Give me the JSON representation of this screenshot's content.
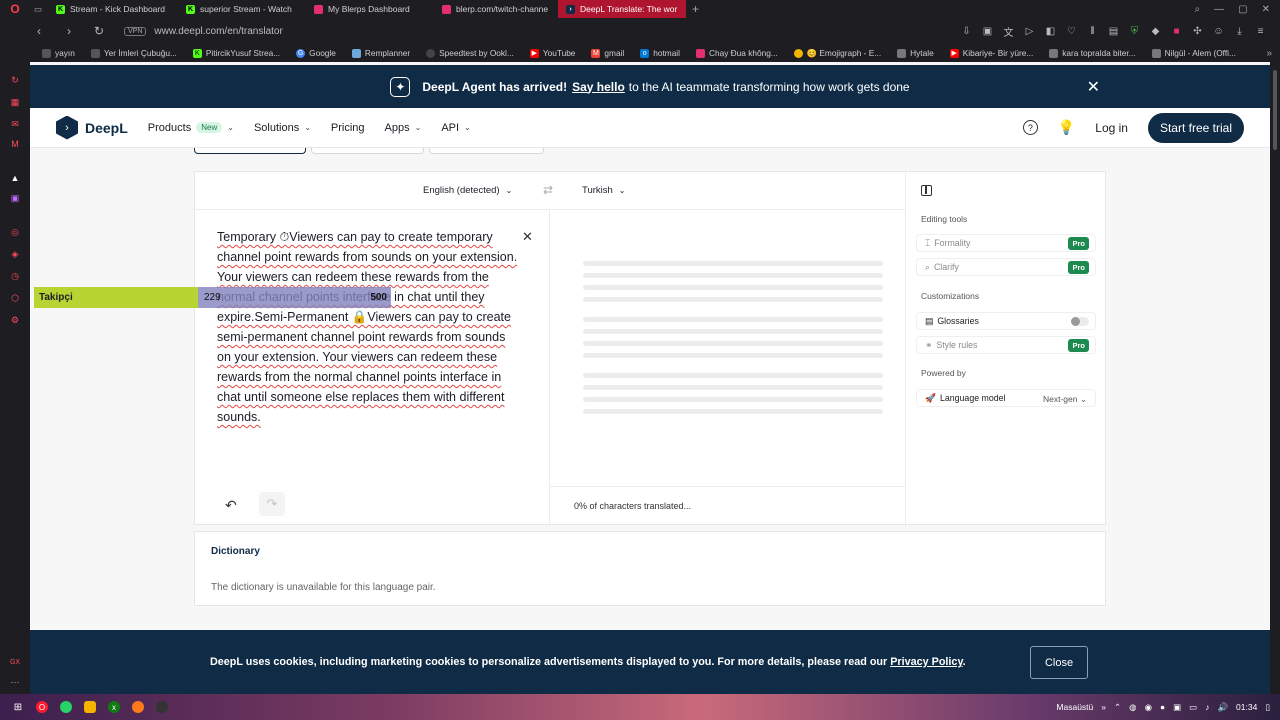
{
  "browser": {
    "tabs": [
      {
        "title": "Stream - Kick Dashboard",
        "color": "#53fc18",
        "glyph": "K"
      },
      {
        "title": "superior Stream - Watch",
        "color": "#53fc18",
        "glyph": "K"
      },
      {
        "title": "My Blerps Dashboard",
        "color": "#e3306c",
        "glyph": ""
      },
      {
        "title": "blerp.com/twitch-channe",
        "color": "#e3306c",
        "glyph": ""
      },
      {
        "title": "DeepL Translate: The wor",
        "color": "#0f2b46",
        "glyph": "D"
      }
    ],
    "url": "www.deepl.com/en/translator",
    "vpn_label": "VPN",
    "bookmarks": [
      {
        "label": "yayın",
        "color": "#888"
      },
      {
        "label": "Yer İmleri Çubuğu...",
        "color": "#888"
      },
      {
        "label": "PitircikYusuf Strea...",
        "color": "#53fc18"
      },
      {
        "label": "Google",
        "color": "#4285f4"
      },
      {
        "label": "Remplanner",
        "color": "#6fa8dc"
      },
      {
        "label": "Speedtest by Ookl...",
        "color": "#666"
      },
      {
        "label": "YouTube",
        "color": "#ff0000"
      },
      {
        "label": "gmail",
        "color": "#ea4335"
      },
      {
        "label": "hotmail",
        "color": "#0078d4"
      },
      {
        "label": "Chạy Đua không...",
        "color": "#e3306c"
      },
      {
        "label": "😊 Emojigraph - E...",
        "color": "#f4b400"
      },
      {
        "label": "Hytale",
        "color": "#777"
      },
      {
        "label": "Kibariye- Bir yüre...",
        "color": "#ff0000"
      },
      {
        "label": "kara topralda biter...",
        "color": "#777"
      },
      {
        "label": "Nilgül - Alem (Offi...",
        "color": "#777"
      }
    ]
  },
  "banner": {
    "title": "DeepL Agent has arrived!",
    "link": "Say hello",
    "rest": "to the AI teammate transforming how work gets done"
  },
  "header": {
    "logo": "DeepL",
    "nav": {
      "products": "Products",
      "new_badge": "New",
      "solutions": "Solutions",
      "pricing": "Pricing",
      "apps": "Apps",
      "api": "API"
    },
    "login": "Log in",
    "trial": "Start free trial"
  },
  "translator": {
    "source_lang": "English (detected)",
    "target_lang": "Turkish",
    "source_text": "Temporary ⏱Viewers can pay to create temporary channel point rewards from sounds on your extension. Your viewers can redeem these rewards from the normal channel points interface in chat until they expire.Semi-Permanent 🔒Viewers can pay to create semi-permanent channel point rewards from sounds on your extension. Your viewers can redeem these rewards from the normal channel points interface in chat until someone else replaces them with different sounds.",
    "progress": "0% of characters translated..."
  },
  "tools": {
    "editing_title": "Editing tools",
    "formality": "Formality",
    "clarify": "Clarify",
    "customizations_title": "Customizations",
    "glossaries": "Glossaries",
    "style_rules": "Style rules",
    "powered_title": "Powered by",
    "language_model": "Language model",
    "model_value": "Next-gen",
    "pro": "Pro"
  },
  "dictionary": {
    "title": "Dictionary",
    "message": "The dictionary is unavailable for this language pair."
  },
  "cookie": {
    "text": "DeepL uses cookies, including marketing cookies to personalize advertisements displayed to you. For more details, please read our",
    "link": "Privacy Policy",
    "close": "Close"
  },
  "overlay": {
    "label": "Takipçi",
    "current": "229",
    "goal": "500",
    "progress_fraction": 0.458
  },
  "taskbar": {
    "desktop_label": "Masaüstü",
    "time": "01:34"
  }
}
